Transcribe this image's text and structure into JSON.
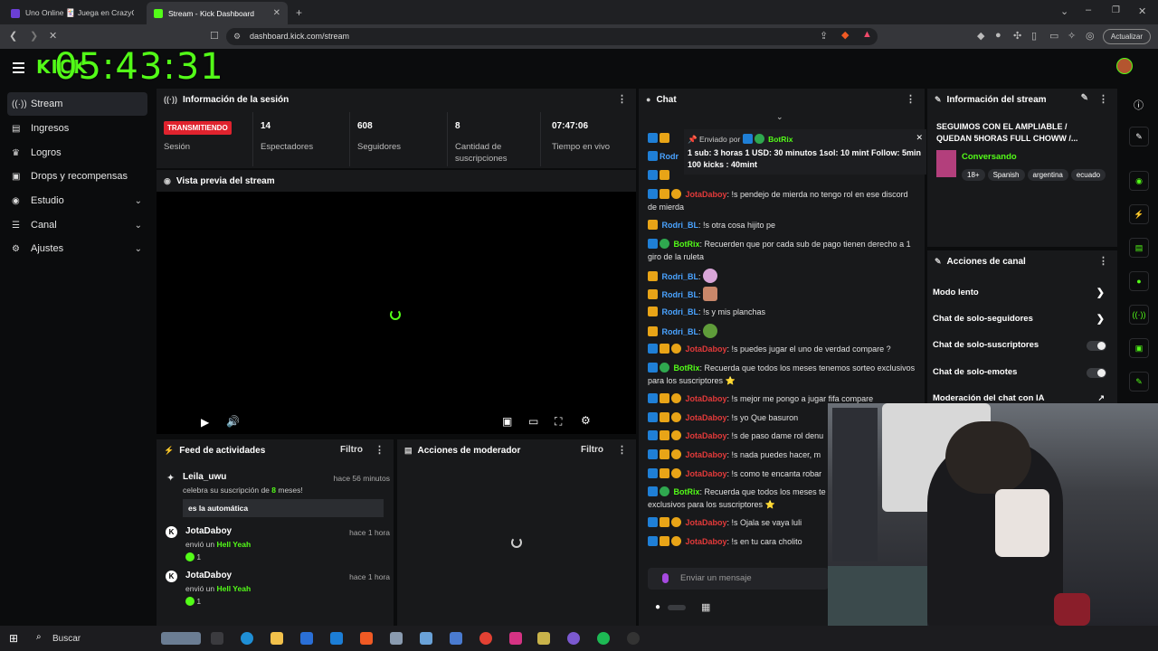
{
  "browser": {
    "tabs": [
      {
        "title": "Uno Online 🃏 Juega en CrazyGam"
      },
      {
        "title": "Stream - Kick Dashboard"
      }
    ],
    "url": "dashboard.kick.com/stream",
    "update_label": "Actualizar"
  },
  "header": {
    "logo": "KICK",
    "clock": "05:43:31"
  },
  "sidebar": {
    "items": [
      {
        "label": "Stream",
        "icon": "broadcast-icon"
      },
      {
        "label": "Ingresos",
        "icon": "money-icon"
      },
      {
        "label": "Logros",
        "icon": "trophy-icon"
      },
      {
        "label": "Drops y recompensas",
        "icon": "gift-icon"
      },
      {
        "label": "Estudio",
        "icon": "studio-icon"
      },
      {
        "label": "Canal",
        "icon": "channel-icon"
      },
      {
        "label": "Ajustes",
        "icon": "gear-icon"
      }
    ]
  },
  "session": {
    "title": "Información de la sesión",
    "status": "TRANSMITIENDO",
    "status_label": "Sesión",
    "stats": [
      {
        "value": "14",
        "label": "Espectadores"
      },
      {
        "value": "608",
        "label": "Seguidores"
      },
      {
        "value": "8",
        "label": "Cantidad de suscripciones"
      },
      {
        "value": "07:47:06",
        "label": "Tiempo en vivo"
      }
    ]
  },
  "preview": {
    "title": "Vista previa del stream"
  },
  "feed": {
    "title": "Feed de actividades",
    "filter_label": "Filtro",
    "items": [
      {
        "user": "Leila_uwu",
        "time": "hace 56 minutos",
        "text_pre": "celebra su suscripción de ",
        "months": "8",
        "text_post": " meses!",
        "message": "es la automática"
      },
      {
        "user": "JotaDaboy",
        "time": "hace 1 hora",
        "text_pre": "envió un ",
        "gift": "Hell Yeah",
        "count": "1"
      },
      {
        "user": "JotaDaboy",
        "time": "hace 1 hora",
        "text_pre": "envió un ",
        "gift": "Hell Yeah",
        "count": "1"
      }
    ]
  },
  "moderator": {
    "title": "Acciones de moderador",
    "filter_label": "Filtro"
  },
  "chat": {
    "title": "Chat",
    "pinned": {
      "label": "Enviado por",
      "user": "BotRix",
      "text": "1 sub: 3 horas 1 USD: 30 minutos 1sol: 10 mint Follow: 5min 100 kicks : 40mint"
    },
    "messages": [
      {
        "user": "JotaDaboy",
        "color": "red",
        "text": ": !s pendejo de mierda no tengo rol en ese discord de mierda"
      },
      {
        "user": "Rodri_BL",
        "color": "blue",
        "text": ": !s otra cosa hijito pe"
      },
      {
        "user": "BotRix",
        "color": "green",
        "text": ": Recuerden que por cada sub de pago tienen derecho a 1 giro de la ruleta"
      },
      {
        "user": "Rodri_BL",
        "color": "blue",
        "text": ":"
      },
      {
        "user": "Rodri_BL",
        "color": "blue",
        "text": ":"
      },
      {
        "user": "Rodri_BL",
        "color": "blue",
        "text": ": !s y mis planchas"
      },
      {
        "user": "Rodri_BL",
        "color": "blue",
        "text": ":"
      },
      {
        "user": "JotaDaboy",
        "color": "red",
        "text": ": !s puedes jugar el uno de verdad compare ?"
      },
      {
        "user": "BotRix",
        "color": "green",
        "text": ": Recuerda que todos los meses tenemos sorteo exclusivos para los suscriptores ⭐"
      },
      {
        "user": "JotaDaboy",
        "color": "red",
        "text": ": !s mejor me pongo a jugar fifa compare"
      },
      {
        "user": "JotaDaboy",
        "color": "red",
        "text": ": !s yo Que basuron"
      },
      {
        "user": "JotaDaboy",
        "color": "red",
        "text": ": !s de paso dame rol denu"
      },
      {
        "user": "JotaDaboy",
        "color": "red",
        "text": ": !s nada puedes hacer, m"
      },
      {
        "user": "JotaDaboy",
        "color": "red",
        "text": ": !s como te encanta robar"
      },
      {
        "user": "BotRix",
        "color": "green",
        "text": ": Recuerda que todos los meses te exclusivos para los suscriptores ⭐"
      },
      {
        "user": "JotaDaboy",
        "color": "red",
        "text": ": !s Ojala se vaya luli"
      },
      {
        "user": "JotaDaboy",
        "color": "red",
        "text": ": !s en tu cara cholito"
      }
    ],
    "input_placeholder": "Enviar un mensaje"
  },
  "stream_info": {
    "title": "Información del stream",
    "stream_title": "SEGUIMOS CON EL AMPLIABLE / QUEDAN 5HORAS FULL CHOWW /...",
    "category": "Conversando",
    "tags": [
      "18+",
      "Spanish",
      "argentina",
      "ecuado"
    ]
  },
  "channel_actions": {
    "title": "Acciones de canal",
    "items": [
      {
        "label": "Modo lento",
        "control": "chevron"
      },
      {
        "label": "Chat de solo-seguidores",
        "control": "chevron"
      },
      {
        "label": "Chat de solo-suscriptores",
        "control": "toggle",
        "on": false
      },
      {
        "label": "Chat de solo-emotes",
        "control": "toggle",
        "on": false
      },
      {
        "label": "Moderación del chat con IA",
        "control": "external"
      }
    ]
  },
  "taskbar": {
    "search_label": "Buscar"
  },
  "colors": {
    "accent": "#53fc18",
    "live": "#e0232e",
    "panel": "#18191b",
    "background": "#0b0c0d"
  }
}
